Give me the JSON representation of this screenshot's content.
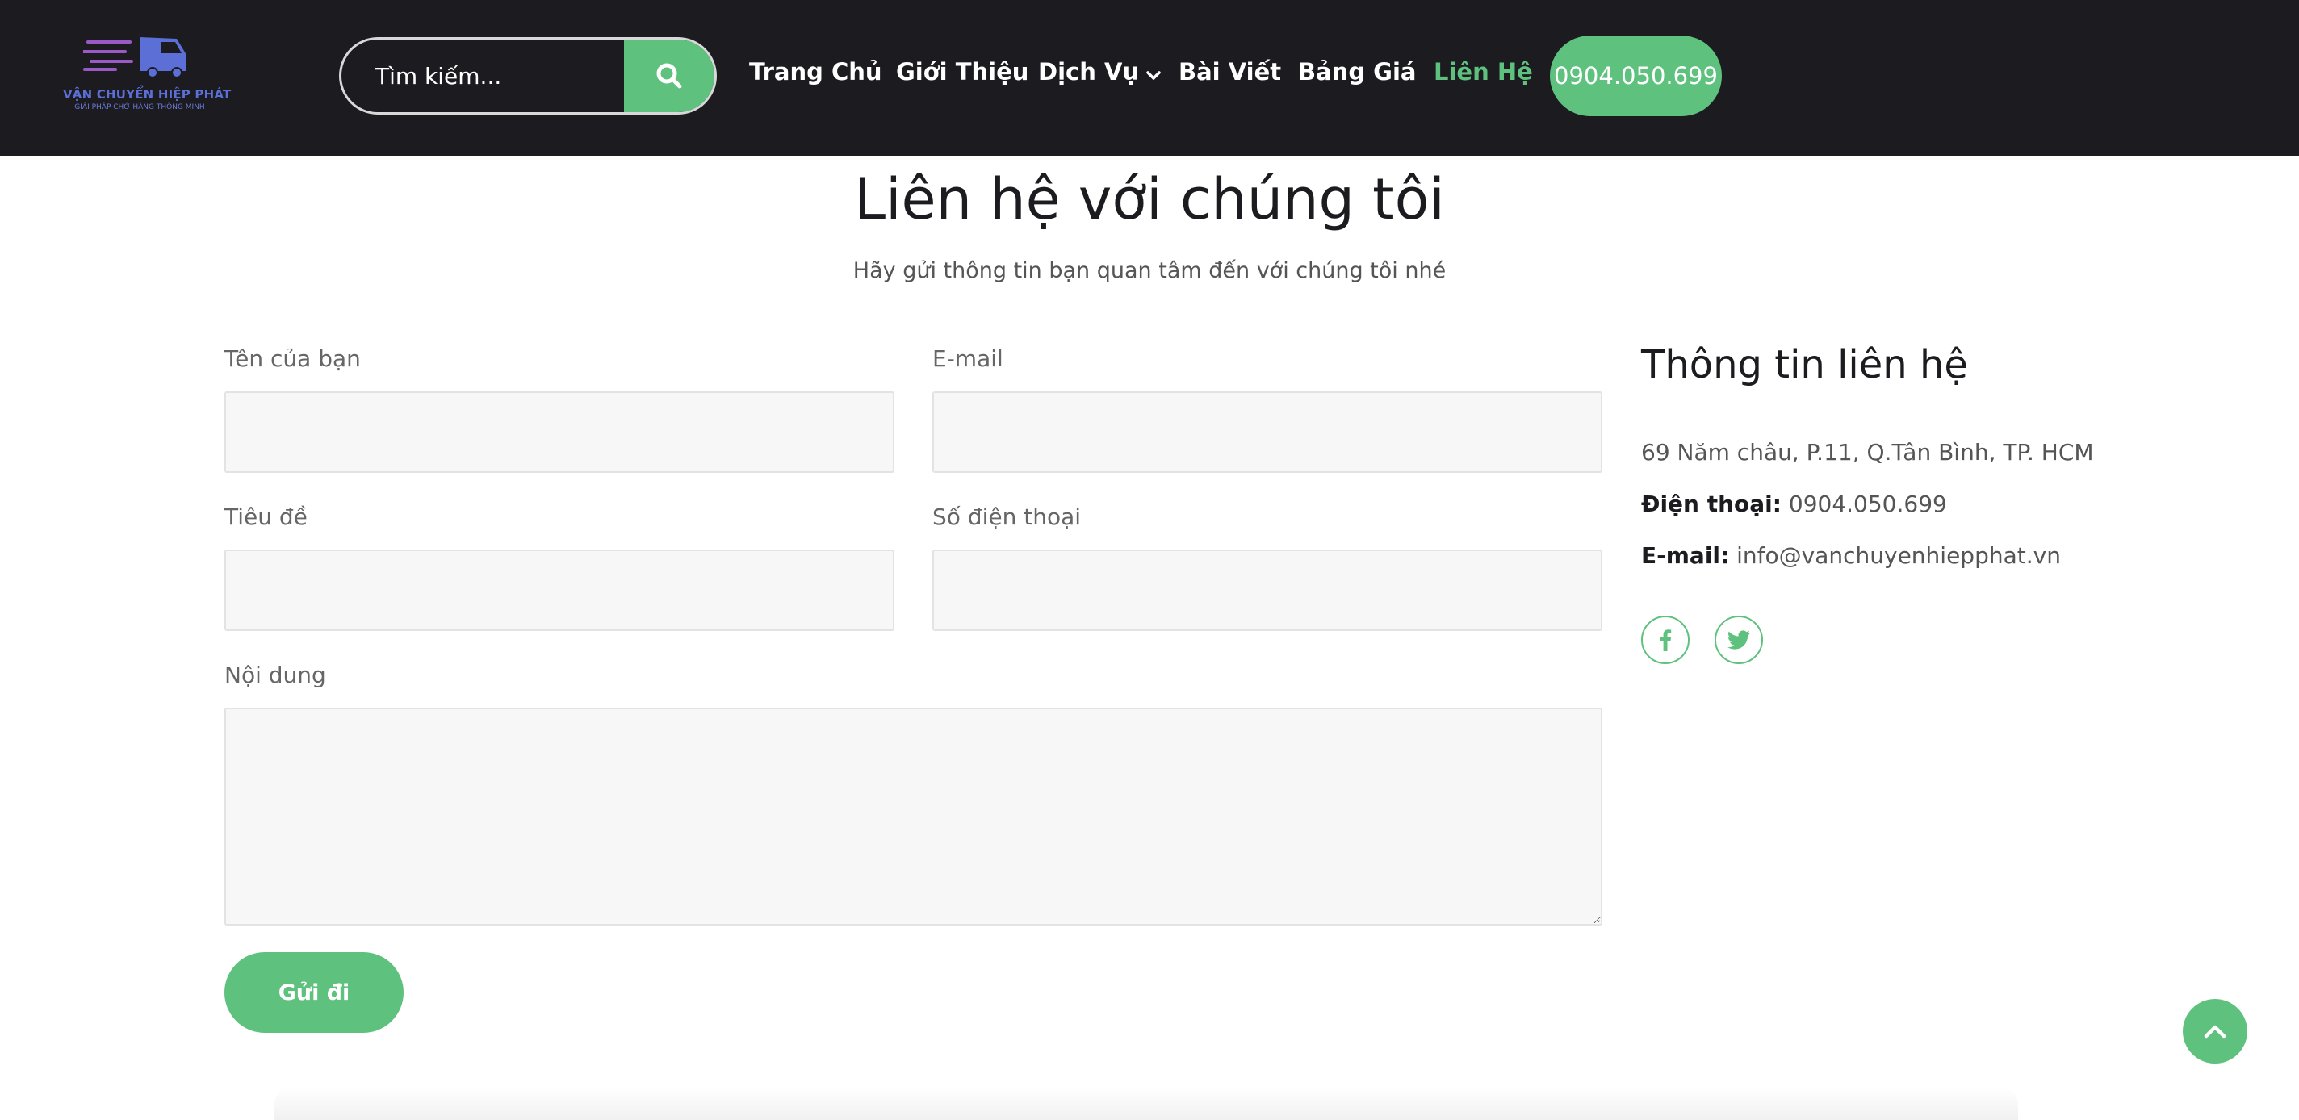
{
  "header": {
    "logo": {
      "title": "VẬN CHUYỂN HIỆP PHÁT",
      "subtitle": "GIẢI PHÁP CHỞ HÀNG THÔNG MINH",
      "icon": "truck-icon"
    },
    "search": {
      "placeholder": "Tìm kiếm...",
      "icon": "search-icon"
    },
    "nav": [
      {
        "label": "Trang Chủ"
      },
      {
        "label": "Giới Thiệu"
      },
      {
        "label": "Dịch Vụ",
        "icon": "chevron-down-icon"
      },
      {
        "label": "Bài Viết"
      },
      {
        "label": "Bảng Giá"
      },
      {
        "label": "Liên Hệ",
        "active": true
      }
    ],
    "phone_button": "0904.050.699"
  },
  "main": {
    "title": "Liên hệ với chúng tôi",
    "subtitle": "Hãy gửi thông tin bạn quan tâm đến với chúng tôi nhé",
    "form": {
      "name_label": "Tên của bạn",
      "email_label": "E-mail",
      "subject_label": "Tiêu đề",
      "phone_label": "Số điện thoại",
      "message_label": "Nội dung",
      "submit_label": "Gửi đi"
    },
    "contact": {
      "title": "Thông tin liên hệ",
      "address": "69 Năm châu, P.11, Q.Tân Bình, TP. HCM",
      "phone_label": "Điện thoại:",
      "phone_value": "0904.050.699",
      "email_label": "E-mail:",
      "email_value": "info@vanchuyenhiepphat.vn",
      "social": [
        "facebook-icon",
        "twitter-icon"
      ]
    }
  },
  "scroll_top_icon": "chevron-up-icon",
  "colors": {
    "header_bg": "#1c1b20",
    "accent": "#5ec17e",
    "logo_blue": "#5b6fd6",
    "logo_purple": "#9b59c6"
  }
}
